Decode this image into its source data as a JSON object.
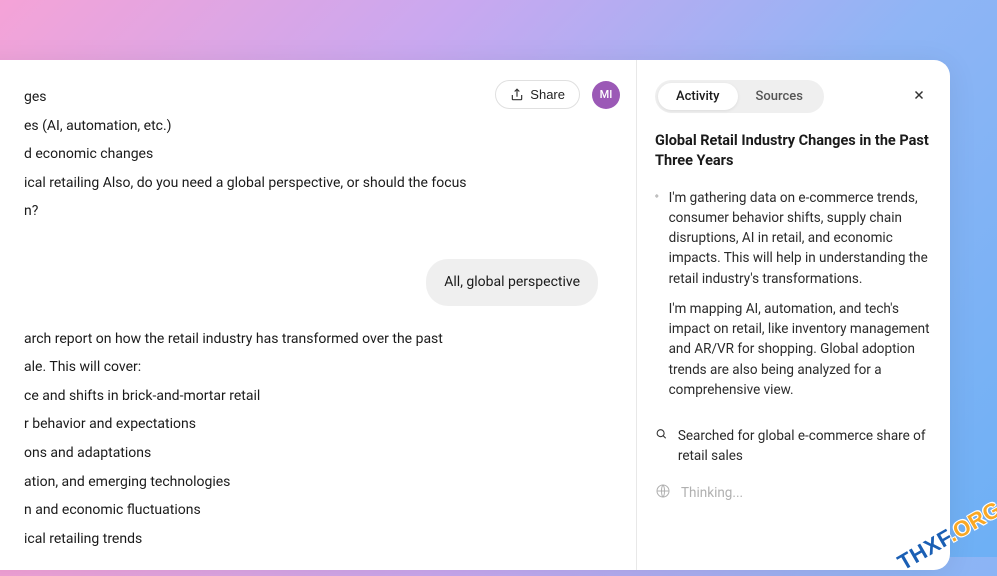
{
  "topbar": {
    "share_label": "Share",
    "avatar_initials": "MI"
  },
  "main": {
    "lines": [
      "ges",
      "es (AI, automation, etc.)",
      "d economic changes",
      "ical retailing Also, do you need a global perspective, or should the focus",
      "n?"
    ],
    "user_message": "All, global perspective",
    "intro": "arch report on how the retail industry has transformed over the past",
    "intro2": "ale. This will cover:",
    "bullets": [
      "ce and shifts in brick-and-mortar retail",
      "r behavior and expectations",
      "ons and adaptations",
      "ation, and emerging technologies",
      "n and economic fluctuations",
      "ical retailing trends"
    ]
  },
  "side": {
    "tabs": {
      "activity": "Activity",
      "sources": "Sources"
    },
    "title": "Global Retail Industry Changes in the Past Three Years",
    "activity1": "I'm gathering data on e-commerce trends, consumer behavior shifts, supply chain disruptions, AI in retail, and economic impacts. This will help in understanding the retail industry's transformations.",
    "activity2": "I'm mapping AI, automation, and tech's impact on retail, like inventory management and AR/VR for shopping. Global adoption trends are also being analyzed for a comprehensive view.",
    "search_text": "Searched for global e-commerce share of retail sales",
    "thinking": "Thinking..."
  },
  "watermark": {
    "part1": "THXF",
    "part2": ".ORG"
  }
}
